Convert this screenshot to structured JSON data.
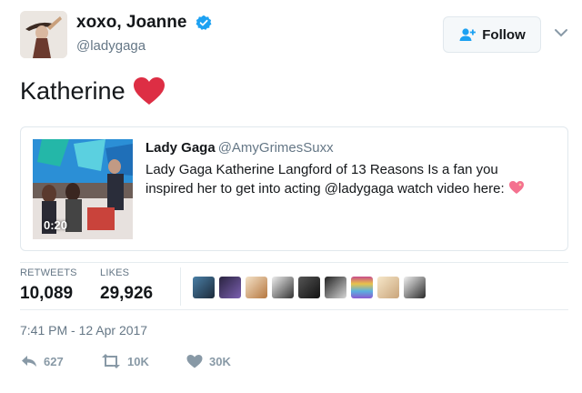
{
  "user": {
    "display_name": "xoxo, Joanne",
    "handle": "@ladygaga",
    "verified_icon": "verified-badge-icon",
    "verified_color": "#1da1f2"
  },
  "follow_button": {
    "label": "Follow",
    "icon": "add-user-icon"
  },
  "tweet": {
    "text": "Katherine",
    "emoji": "red-heart-icon"
  },
  "quote": {
    "author": "Lady Gaga",
    "handle": "@AmyGrimesSuxx",
    "text": "Lady Gaga Katherine Langford of 13 Reasons Is a fan you inspired her to get into acting @ladygaga watch video here:",
    "emoji": "sparkling-heart-icon",
    "video_duration": "0:20"
  },
  "stats": {
    "retweets_label": "RETWEETS",
    "retweets_value": "10,089",
    "likes_label": "LIKES",
    "likes_value": "29,926"
  },
  "likers": [
    "liker-1",
    "liker-2",
    "liker-3",
    "liker-4",
    "liker-5",
    "liker-6",
    "liker-7",
    "liker-8",
    "liker-9",
    "liker-10"
  ],
  "timestamp": "7:41 PM - 12 Apr 2017",
  "actions": {
    "reply_count": "627",
    "retweet_count": "10K",
    "like_count": "30K"
  },
  "colors": {
    "text": "#14171a",
    "muted": "#657786",
    "action_gray": "#8899a6",
    "heart_red": "#e0245e",
    "border": "#e1e8ed"
  }
}
